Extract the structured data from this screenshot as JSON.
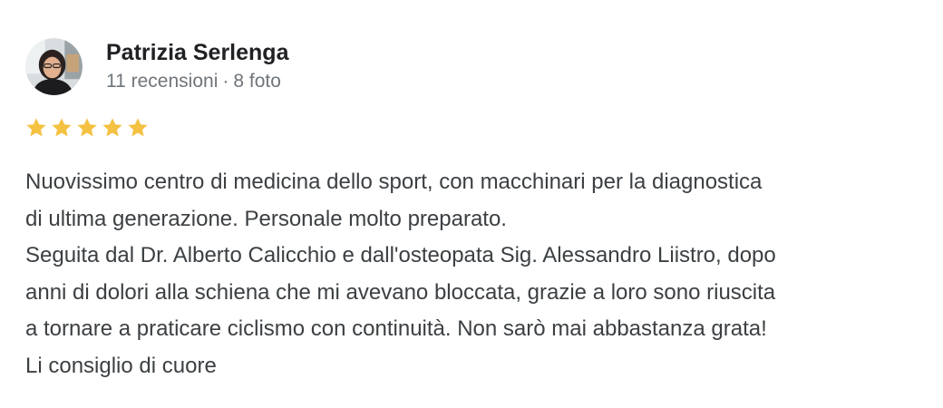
{
  "review": {
    "author": {
      "name": "Patrizia Serlenga",
      "reviews_count": "11 recensioni",
      "separator": "·",
      "photos_count": "8 foto"
    },
    "rating": 5,
    "star_color": "#f4c142",
    "text_lines": [
      "Nuovissimo centro di medicina dello sport, con macchinari per la diagnostica",
      "di ultima generazione. Personale molto preparato.",
      "Seguita dal Dr. Alberto Calicchio e dall'osteopata Sig. Alessandro Liistro, dopo",
      "anni di dolori alla schiena che mi avevano bloccata, grazie a loro sono riuscita",
      "a tornare a praticare ciclismo con continuità. Non sarò mai abbastanza grata!",
      "Li consiglio di cuore"
    ]
  }
}
